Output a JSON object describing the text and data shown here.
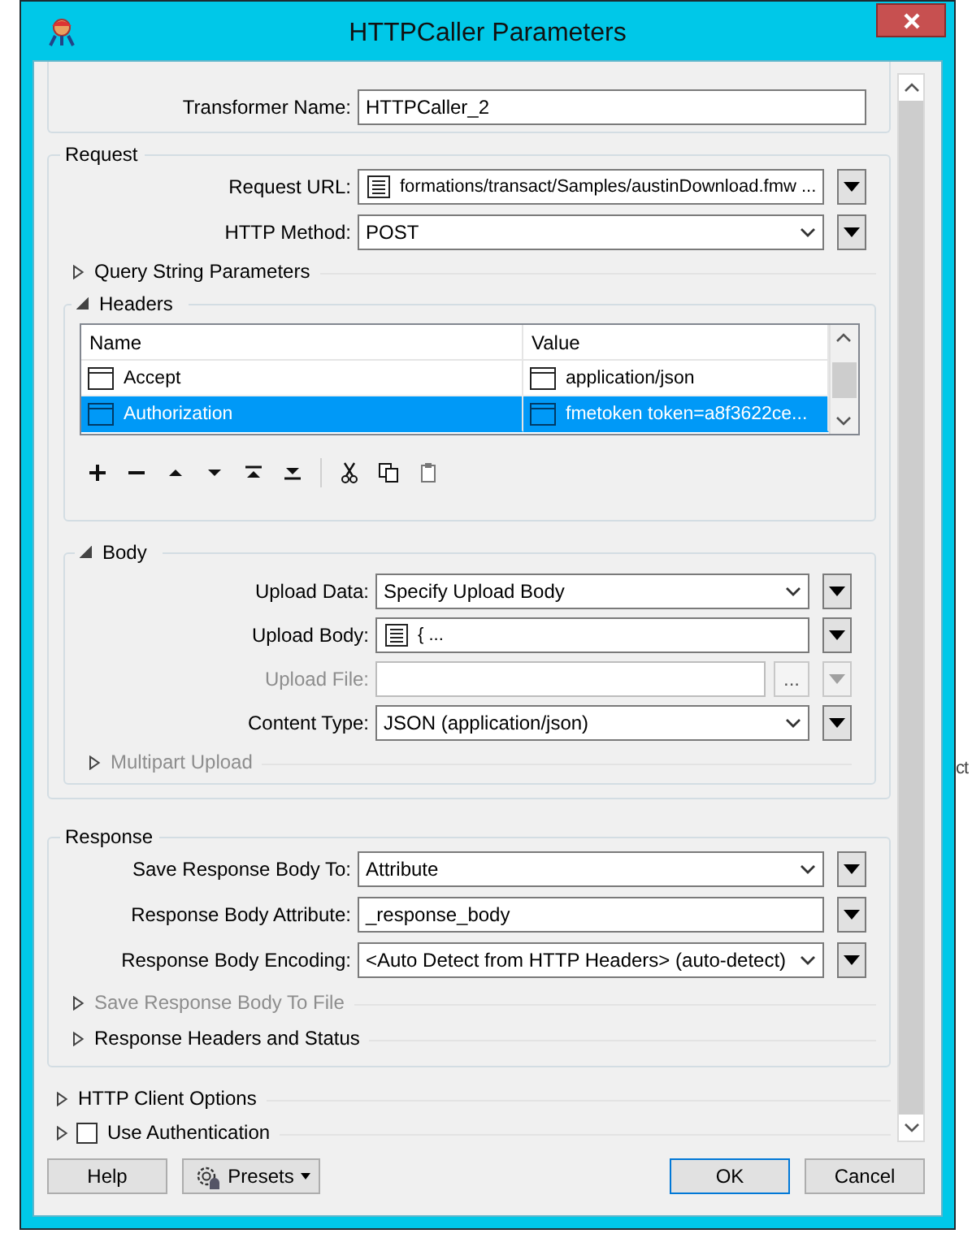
{
  "window": {
    "title": "HTTPCaller Parameters"
  },
  "transformer": {
    "fields": [
      {
        "label": "Transformer Name:",
        "kind": "text",
        "value": "HTTPCaller_2",
        "menu_button": false,
        "disabled": false
      }
    ]
  },
  "request": {
    "title": "Request",
    "fields": [
      {
        "label": "Request URL:",
        "kind": "editor",
        "value": "formations/transact/Samples/austinDownload.fmw ...",
        "menu_button": true,
        "disabled": false
      },
      {
        "label": "HTTP Method:",
        "kind": "select",
        "value": "POST",
        "menu_button": true,
        "disabled": false
      }
    ],
    "query_string": {
      "label": "Query String Parameters",
      "expanded": false,
      "disabled": false
    },
    "headers": {
      "label": "Headers",
      "expanded": true,
      "columns": [
        "Name",
        "Value"
      ],
      "rows": [
        {
          "name": "Accept",
          "value": "application/json",
          "selected": false
        },
        {
          "name": "Authorization",
          "value": "fmetoken token=a8f3622ce...",
          "selected": true
        }
      ]
    },
    "body": {
      "label": "Body",
      "expanded": true,
      "fields": [
        {
          "label": "Upload Data:",
          "kind": "select",
          "value": "Specify Upload Body",
          "menu_button": true,
          "disabled": false
        },
        {
          "label": "Upload Body:",
          "kind": "editor",
          "value": "{ ...",
          "menu_button": true,
          "disabled": false
        },
        {
          "label": "Upload File:",
          "kind": "file",
          "browse_label": "...",
          "menu_button": true,
          "disabled": true
        },
        {
          "label": "Content Type:",
          "kind": "select",
          "value": "JSON (application/json)",
          "menu_button": true,
          "disabled": false
        }
      ],
      "multipart": {
        "label": "Multipart Upload",
        "expanded": false,
        "disabled": true
      }
    }
  },
  "response": {
    "title": "Response",
    "fields": [
      {
        "label": "Save Response Body To:",
        "kind": "select",
        "value": "Attribute",
        "menu_button": true,
        "disabled": false
      },
      {
        "label": "Response Body Attribute:",
        "kind": "text",
        "value": "_response_body",
        "menu_button": true,
        "disabled": false
      },
      {
        "label": "Response Body Encoding:",
        "kind": "select",
        "value": "<Auto Detect from HTTP Headers> (auto-detect)",
        "menu_button": true,
        "disabled": false
      }
    ],
    "sections": [
      {
        "label": "Save Response Body To File",
        "expanded": false,
        "disabled": true
      },
      {
        "label": "Response Headers and Status",
        "expanded": false,
        "disabled": false
      }
    ]
  },
  "http_client_options": {
    "label": "HTTP Client Options",
    "expanded": false,
    "disabled": false
  },
  "use_authentication": {
    "label": "Use Authentication",
    "expanded": false,
    "checked": false
  },
  "buttons": [
    {
      "label": "Help",
      "kind": "plain"
    },
    {
      "label": "Presets",
      "kind": "menu"
    },
    {
      "label": "OK",
      "kind": "default"
    },
    {
      "label": "Cancel",
      "kind": "plain"
    }
  ],
  "background_text": "ct"
}
